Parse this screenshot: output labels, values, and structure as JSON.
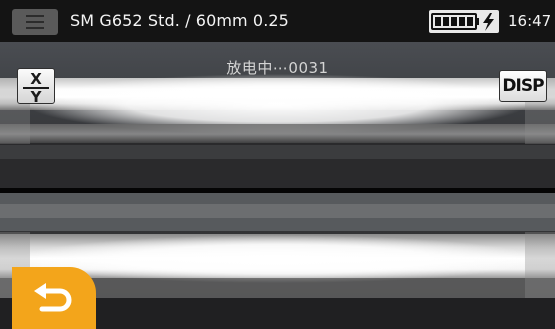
{
  "status_bar": {
    "title": "SM G652 Std. / 60mm 0.25",
    "time": "16:47",
    "menu_icon": "hamburger-menu-icon",
    "battery_icon": "battery-full-icon",
    "charging_icon": "lightning-bolt-icon"
  },
  "camera_view": {
    "status_text": "放电中⋯0031",
    "xy_button": {
      "top": "X",
      "bottom": "Y"
    },
    "disp_button": "DISP",
    "back_icon": "return-arrow-icon"
  },
  "colors": {
    "status_bar_bg": "#141414",
    "back_button": "#f3a51b",
    "button_face": "#f0f0f0"
  }
}
